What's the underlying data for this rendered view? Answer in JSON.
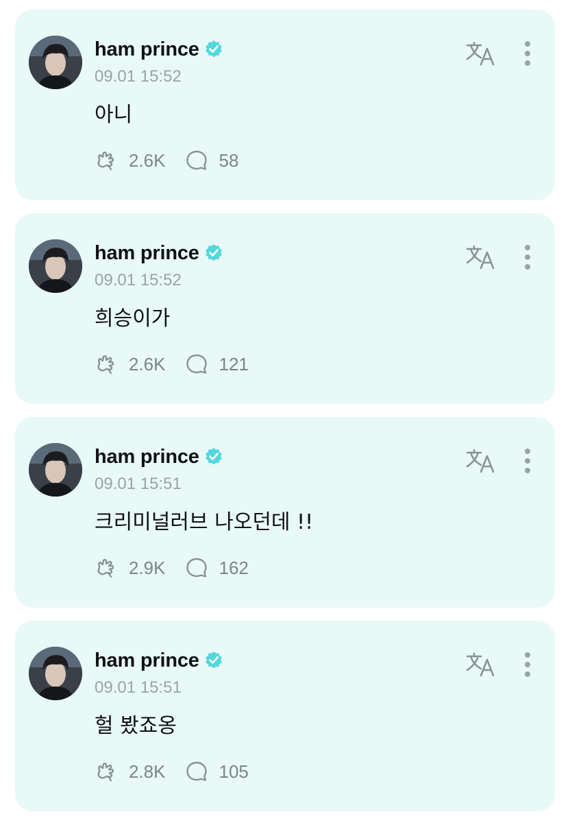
{
  "posts": [
    {
      "author": "ham prince",
      "time": "09.01 15:52",
      "text": "아니",
      "likes": "2.6K",
      "comments": "58"
    },
    {
      "author": "ham prince",
      "time": "09.01 15:52",
      "text": "희승이가",
      "likes": "2.6K",
      "comments": "121"
    },
    {
      "author": "ham prince",
      "time": "09.01 15:51",
      "text": "크리미널러브 나오던데 !!",
      "likes": "2.9K",
      "comments": "162"
    },
    {
      "author": "ham prince",
      "time": "09.01 15:51",
      "text": "헐 봤죠옹",
      "likes": "2.8K",
      "comments": "105"
    }
  ],
  "colors": {
    "card_background": "#e8f9f7",
    "verified_badge": "#52d8de",
    "muted_text": "#9aa3a6"
  },
  "icons": {
    "verified": "verified-badge-icon",
    "translate": "translate-icon",
    "more": "more-vertical-icon",
    "like": "like-hand-icon",
    "comment": "comment-bubble-icon"
  }
}
